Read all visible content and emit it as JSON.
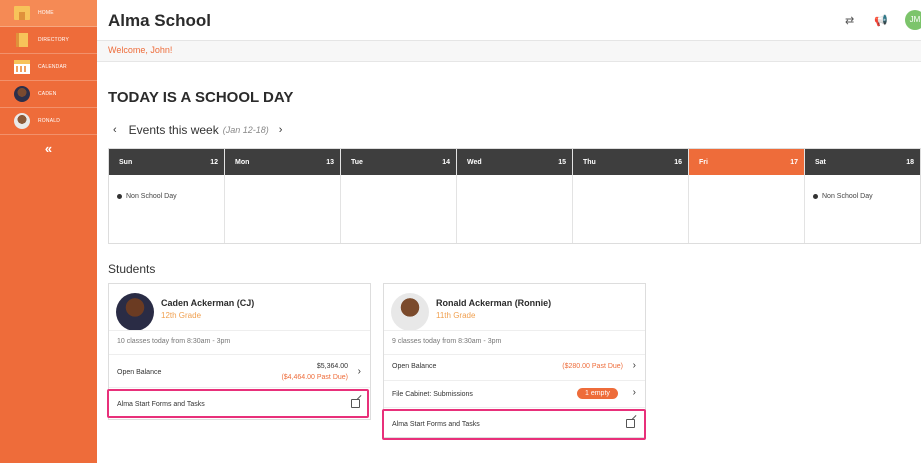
{
  "sidebar": {
    "items": [
      {
        "label": "HOME",
        "icon": "home-icon"
      },
      {
        "label": "DIRECTORY",
        "icon": "directory-icon"
      },
      {
        "label": "CALENDAR",
        "icon": "calendar-icon"
      },
      {
        "label": "CADEN",
        "icon": "avatar"
      },
      {
        "label": "RONALD",
        "icon": "avatar"
      }
    ],
    "collapse_glyph": "«"
  },
  "header": {
    "title": "Alma School",
    "avatar_initials": "JM"
  },
  "welcome": "Welcome, John!",
  "main": {
    "heading": "TODAY IS A SCHOOL DAY",
    "events_title": "Events this week",
    "events_range": "(Jan 12-18)",
    "days": [
      {
        "name": "Sun",
        "num": "12",
        "event": "Non School Day"
      },
      {
        "name": "Mon",
        "num": "13",
        "event": ""
      },
      {
        "name": "Tue",
        "num": "14",
        "event": ""
      },
      {
        "name": "Wed",
        "num": "15",
        "event": ""
      },
      {
        "name": "Thu",
        "num": "16",
        "event": ""
      },
      {
        "name": "Fri",
        "num": "17",
        "event": ""
      },
      {
        "name": "Sat",
        "num": "18",
        "event": "Non School Day"
      }
    ],
    "students_label": "Students"
  },
  "students": [
    {
      "name": "Caden Ackerman (CJ)",
      "grade": "12th Grade",
      "classes": "10 classes today from 8:30am - 3pm",
      "balance_label": "Open Balance",
      "balance_amount": "$5,364.00",
      "balance_pastdue": "($4,464.00 Past Due)",
      "forms_label": "Alma Start Forms and Tasks"
    },
    {
      "name": "Ronald Ackerman (Ronnie)",
      "grade": "11th Grade",
      "classes": "9 classes today from 8:30am - 3pm",
      "balance_label": "Open Balance",
      "balance_pastdue": "($280.00 Past Due)",
      "file_label": "File Cabinet: Submissions",
      "file_pill": "1 empty",
      "forms_label": "Alma Start Forms and Tasks"
    }
  ],
  "colors": {
    "accent": "#ee6c3a",
    "highlight": "#e8307a",
    "dark_header": "#3e3e3e"
  }
}
